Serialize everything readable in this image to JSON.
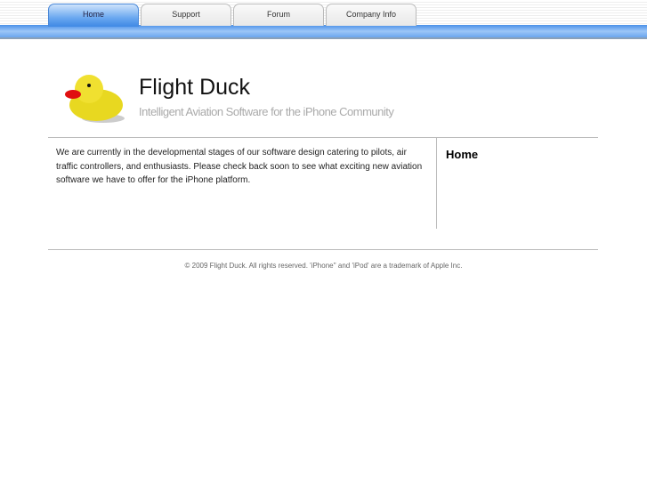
{
  "nav": {
    "tabs": [
      {
        "label": "Home",
        "active": true
      },
      {
        "label": "Support"
      },
      {
        "label": "Forum"
      },
      {
        "label": "Company Info"
      }
    ]
  },
  "header": {
    "title": "Flight Duck",
    "tagline": "Intelligent Aviation Software for the iPhone Community",
    "logo_icon": "rubber-duck-icon"
  },
  "main": {
    "text": "We are currently in the developmental stages of our software design catering to pilots, air traffic controllers, and enthusiasts. Please check back soon to see what exciting new aviation software we have to offer for the iPhone platform."
  },
  "sidebar": {
    "heading": "Home"
  },
  "footer": {
    "text": "© 2009 Flight Duck. All rights reserved. 'iPhone'' and 'iPod' are a trademark of Apple Inc."
  }
}
